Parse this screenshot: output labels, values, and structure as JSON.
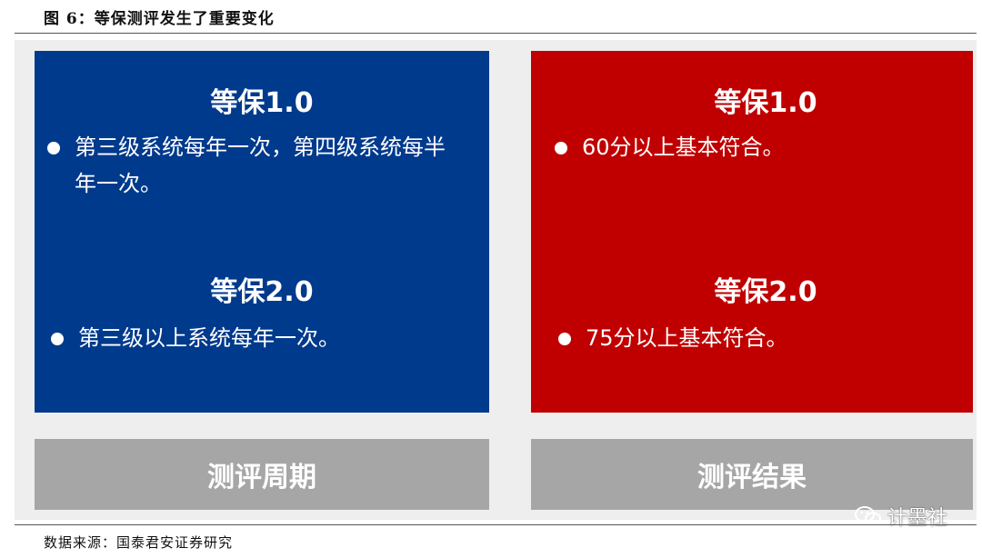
{
  "figure": {
    "title": "图 6：等保测评发生了重要变化",
    "source": "数据来源：国泰君安证券研究"
  },
  "cards": {
    "cycle": {
      "color": "#003a8c",
      "v1_heading": "等保1.0",
      "v1_text": "第三级系统每年一次，第四级系统每半年一次。",
      "v2_heading": "等保2.0",
      "v2_text": "第三级以上系统每年一次。",
      "label": "测评周期"
    },
    "result": {
      "color": "#c00000",
      "v1_heading": "等保1.0",
      "v1_text": "60分以上基本符合。",
      "v2_heading": "等保2.0",
      "v2_text": "75分以上基本符合。",
      "label": "测评结果"
    }
  },
  "watermark": {
    "icon": "wechat-icon",
    "text": "计墨社"
  }
}
